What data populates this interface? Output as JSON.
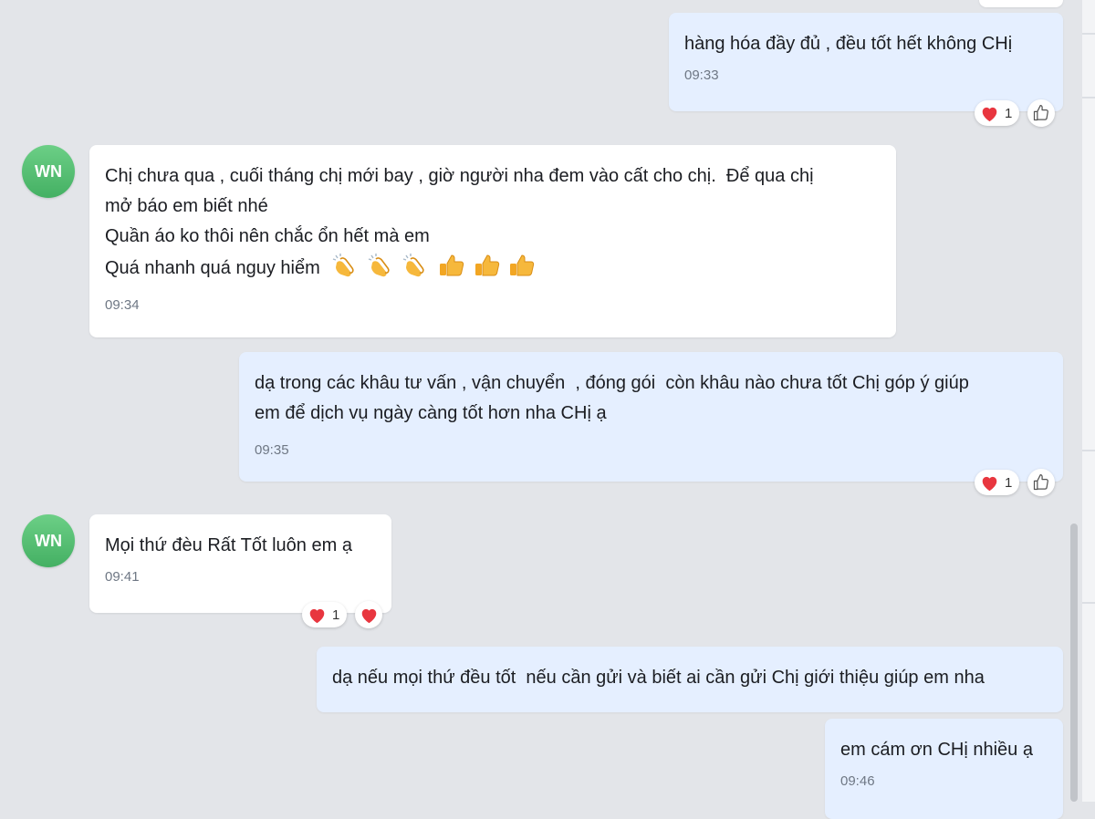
{
  "messages": [
    {
      "sender": "me",
      "lines": [
        "hàng hóa đầy đủ , đều tốt hết không CHị"
      ],
      "time": "09:33",
      "reaction_count": "1"
    },
    {
      "sender": "WN",
      "avatar": "WN",
      "lines": [
        "Chị chưa qua , cuối tháng chị mới bay , giờ người nha đem vào cất cho chị.  Để qua chị",
        "mở báo em biết nhé",
        "Quần áo ko thôi nên chắc ổn hết mà em",
        "Quá nhanh quá nguy hiểm"
      ],
      "time": "09:34"
    },
    {
      "sender": "me",
      "lines": [
        "dạ trong các khâu tư vấn , vận chuyển  , đóng gói  còn khâu nào chưa tốt Chị góp ý giúp",
        "em để dịch vụ ngày càng tốt hơn nha CHị ạ"
      ],
      "time": "09:35",
      "reaction_count": "1"
    },
    {
      "sender": "WN",
      "avatar": "WN",
      "lines": [
        "Mọi thứ đèu Rất Tốt luôn em ạ"
      ],
      "time": "09:41",
      "reaction_count": "1"
    },
    {
      "sender": "me",
      "lines": [
        "dạ nếu mọi thứ đều tốt  nếu cần gửi và biết ai cần gửi Chị giới thiệu giúp em nha"
      ]
    },
    {
      "sender": "me",
      "lines": [
        "em cám ơn CHị nhiều ạ"
      ],
      "time": "09:46"
    }
  ],
  "emoji_sequence": [
    "clapping-hands",
    "clapping-hands",
    "clapping-hands",
    "thumbs-up",
    "thumbs-up",
    "thumbs-up"
  ],
  "icons": {
    "reaction": "heart-icon",
    "like": "thumbs-up-outline-icon"
  },
  "colors": {
    "incoming_bubble": "#ffffff",
    "outgoing_bubble": "#e5efff",
    "avatar": "#4fbf6c",
    "heart": "#e8363f",
    "background": "#e3e5e9"
  }
}
